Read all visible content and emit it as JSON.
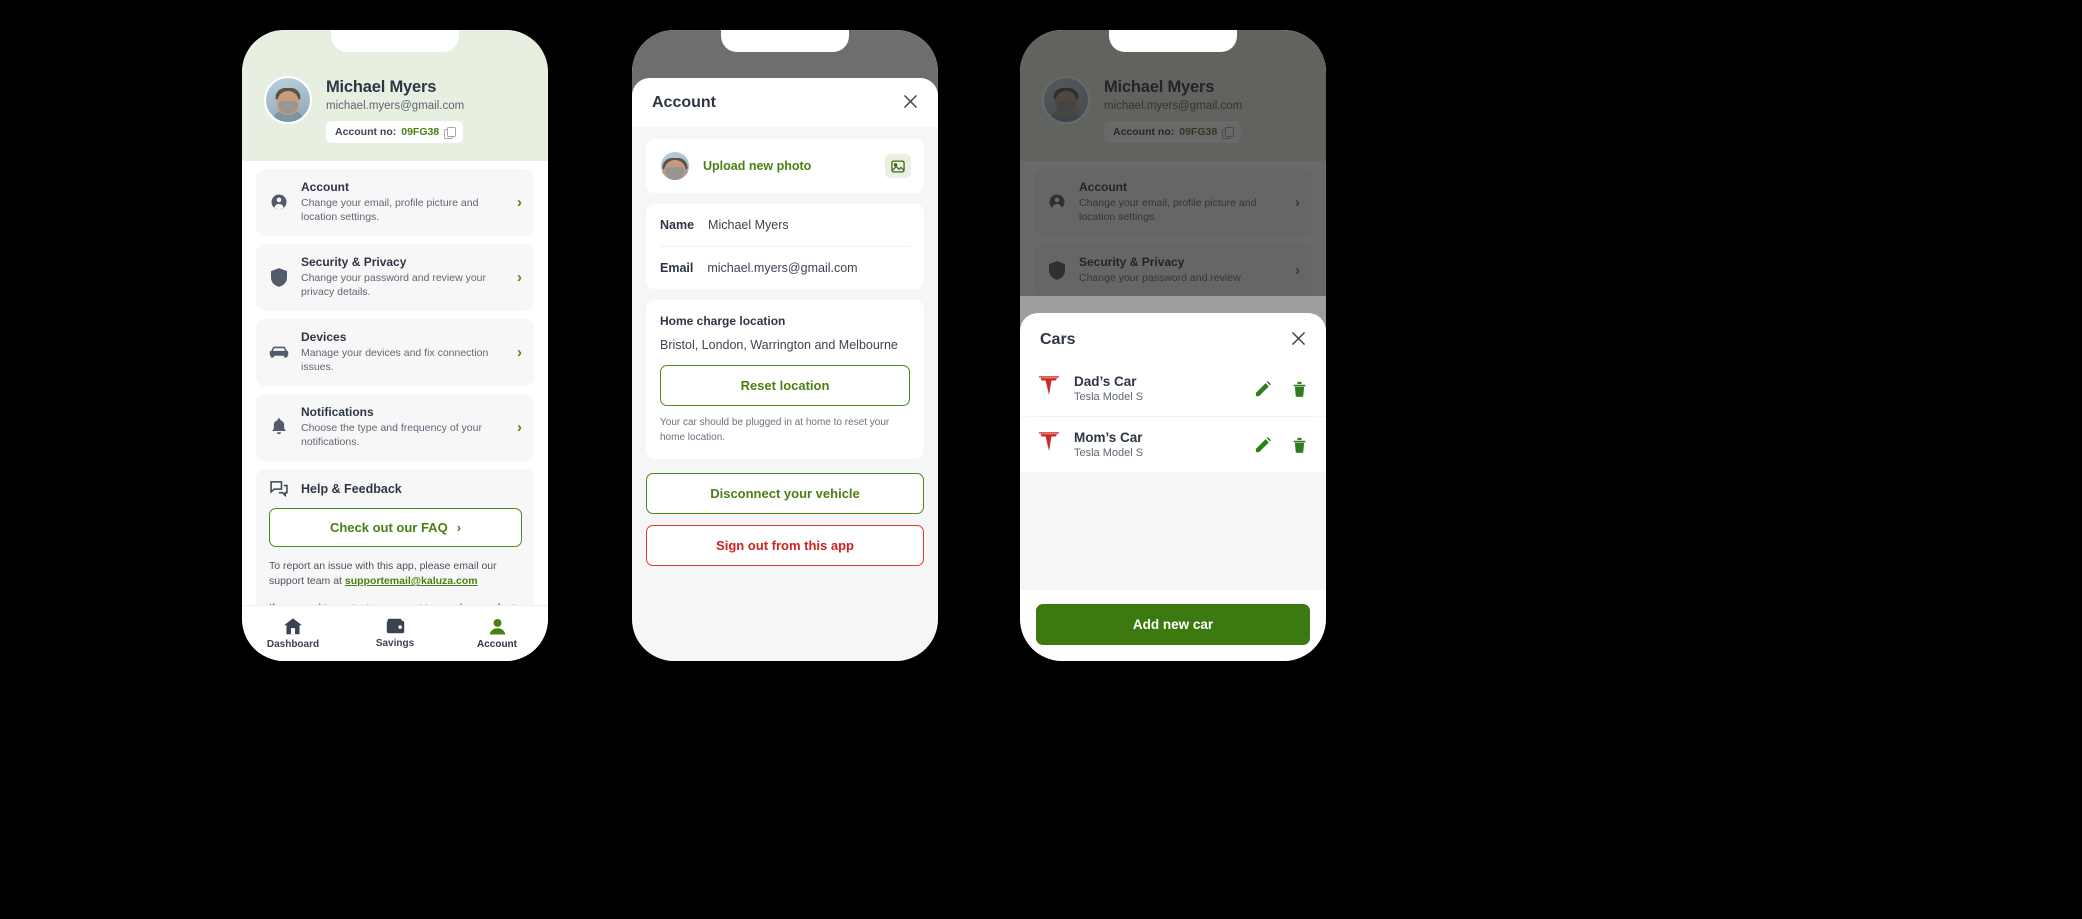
{
  "colors": {
    "brand_green": "#4b7f12",
    "button_green": "#3c7a11",
    "danger_red": "#cc2222",
    "hero_bg": "#e7efe1",
    "text_dark": "#2e3645",
    "tesla_red": "#cc2a27"
  },
  "phone1": {
    "profile": {
      "name": "Michael Myers",
      "email": "michael.myers@gmail.com",
      "account_label": "Account no:",
      "account_number": "09FG38",
      "copy_icon": "copy-icon",
      "avatar_icon": "avatar-photo"
    },
    "menu": [
      {
        "icon": "person-icon",
        "title": "Account",
        "subtitle": "Change your email, profile picture and location settings.",
        "chevron": "›"
      },
      {
        "icon": "shield-icon",
        "title": "Security & Privacy",
        "subtitle": "Change your password and review your privacy details.",
        "chevron": "›"
      },
      {
        "icon": "car-icon",
        "title": "Devices",
        "subtitle": "Manage your devices and fix connection issues.",
        "chevron": "›"
      },
      {
        "icon": "bell-icon",
        "title": "Notifications",
        "subtitle": "Choose the type and frequency of your notifications.",
        "chevron": "›"
      }
    ],
    "help": {
      "icon": "chat-icon",
      "title": "Help & Feedback",
      "faq_button": "Check out our FAQ",
      "faq_chevron": "›",
      "paragraph1_before": "To report an issue with this app, please email our support team at ",
      "support_email": "supportemail@kaluza.com",
      "paragraph2": "If you need to contact ou support team, please refer to your account number:"
    },
    "tabs": [
      {
        "icon": "home-icon",
        "label": "Dashboard",
        "active": false
      },
      {
        "icon": "wallet-icon",
        "label": "Savings",
        "active": false
      },
      {
        "icon": "account-icon",
        "label": "Account",
        "active": true
      }
    ]
  },
  "phone2": {
    "sheet_title": "Account",
    "close_icon": "close-icon",
    "upload": {
      "avatar_icon": "avatar-photo",
      "label": "Upload new photo",
      "image_icon": "image-icon"
    },
    "fields": [
      {
        "label": "Name",
        "value": "Michael Myers"
      },
      {
        "label": "Email",
        "value": "michael.myers@gmail.com"
      }
    ],
    "location": {
      "title": "Home charge location",
      "value": "Bristol, London, Warrington and Melbourne",
      "reset_button": "Reset location",
      "note": "Your car should be plugged in at home to reset your home location."
    },
    "disconnect_button": "Disconnect your vehicle",
    "signout_button": "Sign out from this app"
  },
  "phone3": {
    "background": {
      "name": "Michael Myers",
      "email": "michael.myers@gmail.com",
      "account_label": "Account no:",
      "account_number": "09FG38",
      "menu": [
        {
          "title": "Account",
          "subtitle": "Change your email, profile picture and location settings."
        },
        {
          "title": "Security & Privacy",
          "subtitle": "Change your password and review"
        }
      ]
    },
    "sheet_title": "Cars",
    "close_icon": "close-icon",
    "cars": [
      {
        "brand_icon": "tesla-logo-icon",
        "name": "Dad’s Car",
        "model": "Tesla Model S",
        "edit_icon": "pencil-icon",
        "delete_icon": "trash-icon"
      },
      {
        "brand_icon": "tesla-logo-icon",
        "name": "Mom’s Car",
        "model": "Tesla Model S",
        "edit_icon": "pencil-icon",
        "delete_icon": "trash-icon"
      }
    ],
    "add_button": "Add new car"
  }
}
